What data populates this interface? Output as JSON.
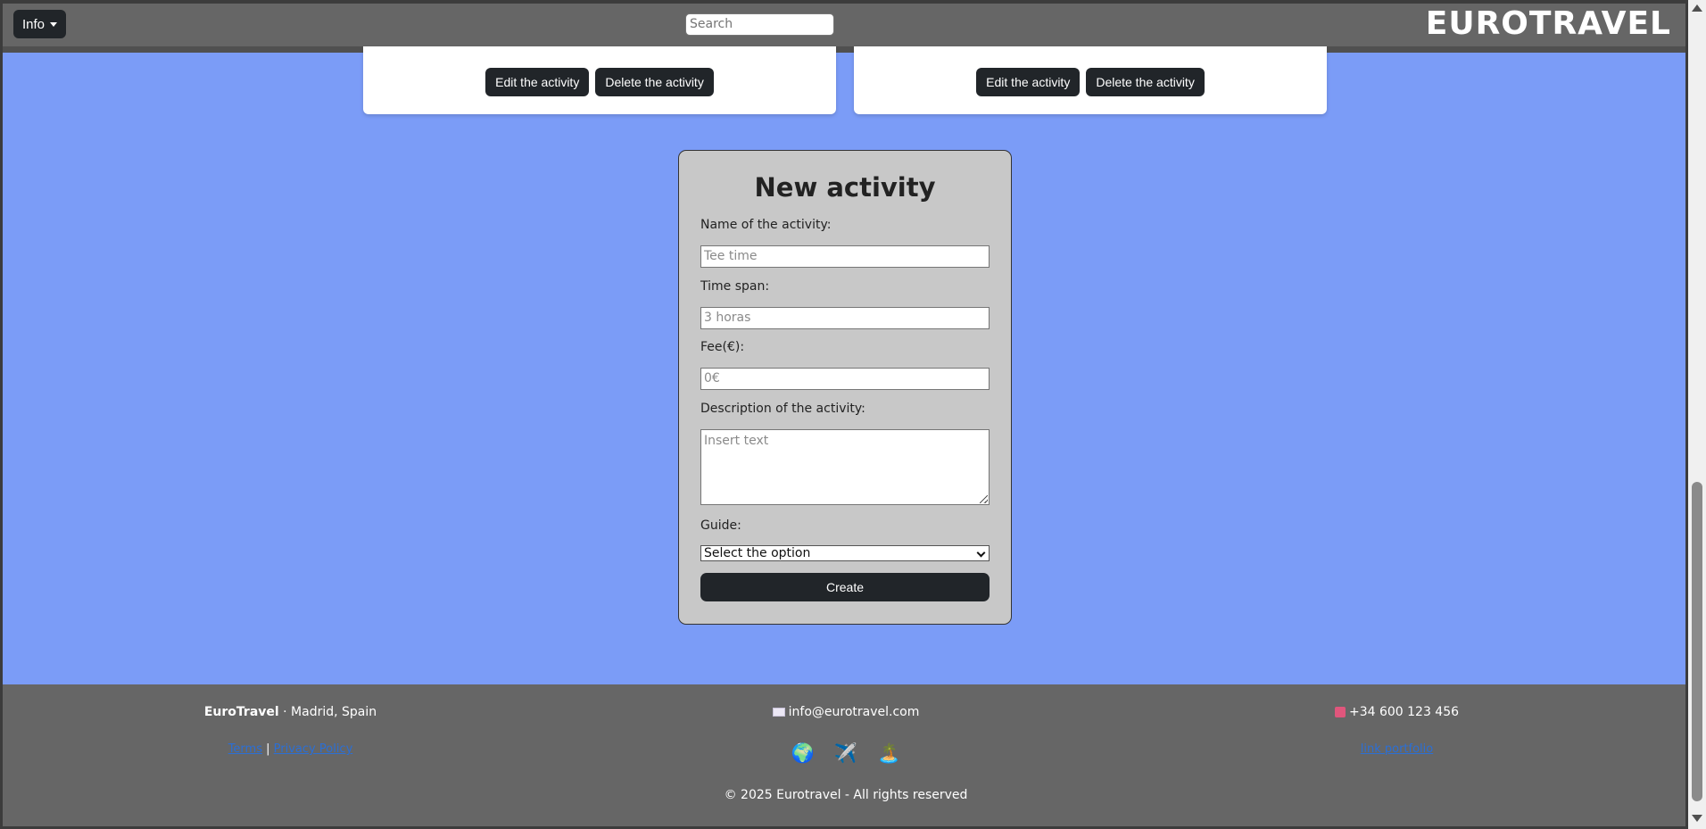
{
  "navbar": {
    "info_label": "Info",
    "search_placeholder": "Search",
    "brand": "EUROTRAVEL"
  },
  "cards": [
    {
      "edit_label": "Edit the activity",
      "delete_label": "Delete the activity"
    },
    {
      "edit_label": "Edit the activity",
      "delete_label": "Delete the activity"
    }
  ],
  "form": {
    "title": "New activity",
    "name_label": "Name of the activity:",
    "name_placeholder": "Tee time",
    "time_label": "Time span:",
    "time_placeholder": "3 horas",
    "fee_label": "Fee(€):",
    "fee_placeholder": "0€",
    "description_label": "Description of the activity:",
    "description_placeholder": "Insert text",
    "guide_label": "Guide:",
    "guide_selected": "Select the option",
    "create_label": "Create"
  },
  "footer": {
    "brand": "EuroTravel",
    "location": " · Madrid, Spain",
    "terms": "Terms",
    "separator": "|",
    "privacy": "Privacy Policy",
    "email": "info@eurotravel.com",
    "phone": "+34 600 123 456",
    "portfolio": "link portfolio",
    "icons": [
      "🌍",
      "✈️",
      "🏝️"
    ],
    "copyright": "© 2025 Eurotravel - All rights reserved"
  },
  "colors": {
    "background": "#7b9cf7",
    "navbar": "#666666",
    "button_dark": "#212529",
    "form_card": "#c8c8c8",
    "link": "#2b6fd6"
  }
}
